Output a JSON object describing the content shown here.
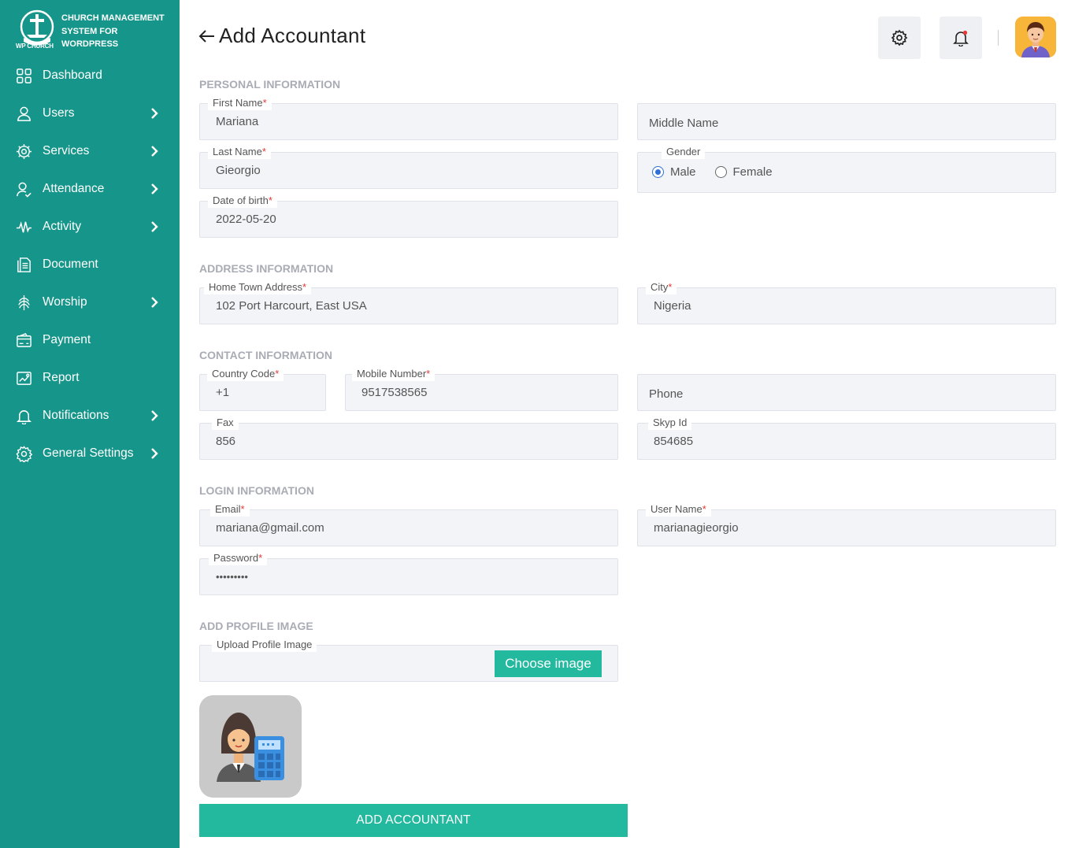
{
  "brand": {
    "title": "CHURCH MANAGEMENT SYSTEM FOR WORDPRESS",
    "sub": "WP CHURCH"
  },
  "sidebar": {
    "items": [
      {
        "label": "Dashboard",
        "icon": "grid-icon"
      },
      {
        "label": "Users",
        "icon": "user-icon"
      },
      {
        "label": "Services",
        "icon": "services-icon"
      },
      {
        "label": "Attendance",
        "icon": "attendance-icon"
      },
      {
        "label": "Activity",
        "icon": "activity-icon"
      },
      {
        "label": "Document",
        "icon": "document-icon"
      },
      {
        "label": "Worship",
        "icon": "worship-icon"
      },
      {
        "label": "Payment",
        "icon": "payment-icon"
      },
      {
        "label": "Report",
        "icon": "report-icon"
      },
      {
        "label": "Notifications",
        "icon": "bell-icon"
      },
      {
        "label": "General Settings",
        "icon": "gear-icon"
      }
    ]
  },
  "header": {
    "title": "Add Accountant"
  },
  "sections": {
    "personal": "PERSONAL INFORMATION",
    "address": "ADDRESS INFORMATION",
    "contact": "CONTACT INFORMATION",
    "login": "LOGIN INFORMATION",
    "image": "ADD PROFILE IMAGE"
  },
  "fields": {
    "first_name": {
      "label": "First Name",
      "value": "Mariana"
    },
    "middle_name": {
      "placeholder": "Middle Name"
    },
    "last_name": {
      "label": "Last Name",
      "value": "Gieorgio"
    },
    "gender": {
      "label": "Gender",
      "options": [
        "Male",
        "Female"
      ],
      "selected": "Male"
    },
    "dob": {
      "label": "Date of birth",
      "value": "2022-05-20"
    },
    "address": {
      "label": "Home Town Address",
      "value": "102 Port Harcourt, East USA"
    },
    "city": {
      "label": "City",
      "value": "Nigeria"
    },
    "country_code": {
      "label": "Country Code",
      "value": "+1"
    },
    "mobile": {
      "label": "Mobile Number",
      "value": "9517538565"
    },
    "phone": {
      "placeholder": "Phone"
    },
    "fax": {
      "label": "Fax",
      "value": "856"
    },
    "skype": {
      "label": "Skyp Id",
      "value": "854685"
    },
    "email": {
      "label": "Email",
      "value": "mariana@gmail.com"
    },
    "username": {
      "label": "User Name",
      "value": "marianagieorgio"
    },
    "password": {
      "label": "Password",
      "value": "•••••••••"
    },
    "upload": {
      "label": "Upload Profile Image",
      "button": "Choose image"
    }
  },
  "required_mark": "*",
  "submit_label": "ADD ACCOUNTANT",
  "colors": {
    "sidebar": "#16958a",
    "accent": "#23b99f",
    "field_bg": "#f2f4f8",
    "section_title": "#a9acb4",
    "required": "#e53935"
  }
}
